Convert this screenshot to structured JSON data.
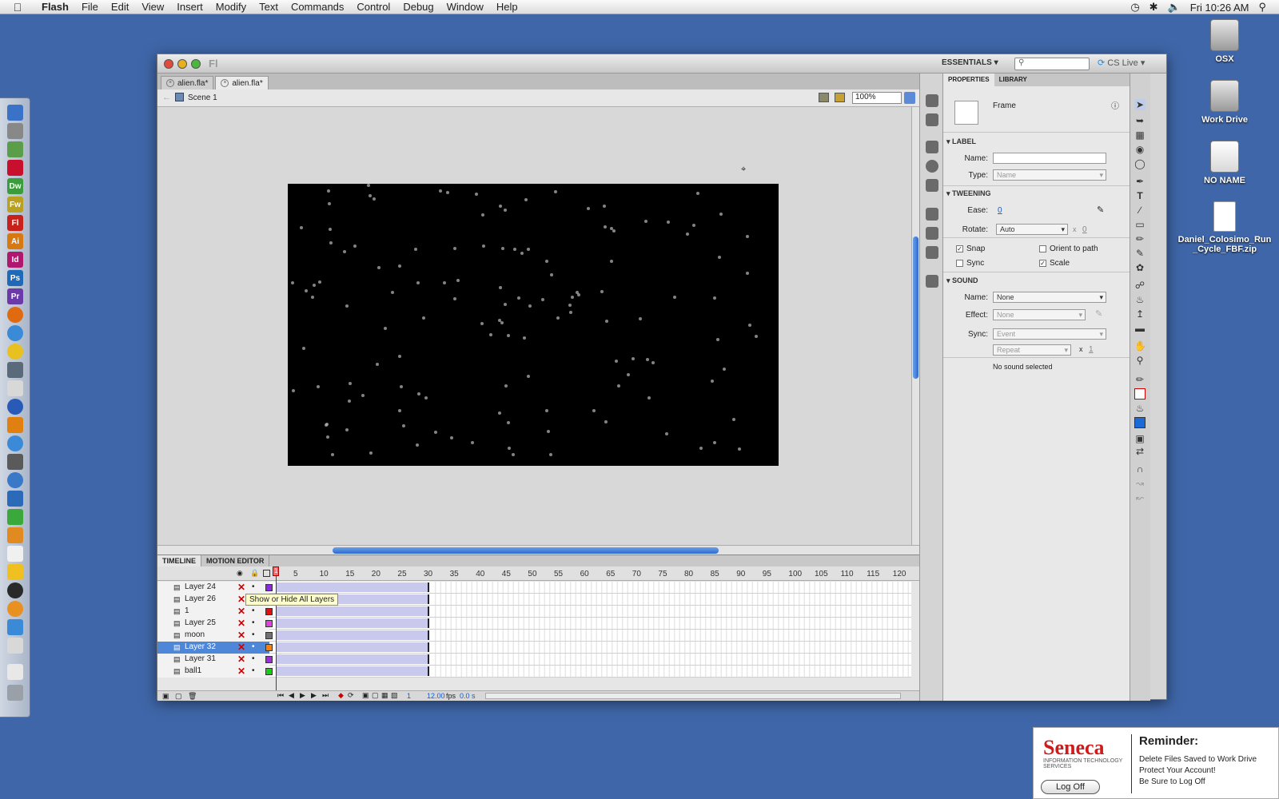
{
  "menubar": {
    "app": "Flash",
    "items": [
      "File",
      "Edit",
      "View",
      "Insert",
      "Modify",
      "Text",
      "Commands",
      "Control",
      "Debug",
      "Window",
      "Help"
    ],
    "clock": "Fri 10:26 AM"
  },
  "desktop": {
    "icons": [
      {
        "label": "OSX"
      },
      {
        "label": "Work Drive"
      },
      {
        "label": "NO NAME"
      },
      {
        "label": "Daniel_Colosimo_Run_Cycle_FBF.zip"
      }
    ]
  },
  "dock": {
    "apps": [
      "Dw",
      "Fw",
      "Fl",
      "Ai",
      "Id",
      "Ps",
      "Pr"
    ]
  },
  "window": {
    "title_logo": "Fl",
    "workspace": "ESSENTIALS",
    "cslive": "CS Live",
    "tabs": [
      "alien.fla*",
      "alien.fla*"
    ],
    "breadcrumb": "Scene 1",
    "zoom": "100%"
  },
  "timeline": {
    "tabs": [
      "TIMELINE",
      "MOTION EDITOR"
    ],
    "frame_numbers": [
      "5",
      "10",
      "15",
      "20",
      "25",
      "30",
      "35",
      "40",
      "45",
      "50",
      "55",
      "60",
      "65",
      "70",
      "75",
      "80",
      "85",
      "90",
      "95",
      "100",
      "105",
      "110",
      "115",
      "120"
    ],
    "current_frame_marker": "1",
    "tooltip": "Show or Hide All Layers",
    "layers": [
      {
        "name": "Layer 24",
        "color": "#8a2be2"
      },
      {
        "name": "Layer 26",
        "color": "#3f8fe0"
      },
      {
        "name": "1",
        "color": "#e01010"
      },
      {
        "name": "Layer 25",
        "color": "#e040e0"
      },
      {
        "name": "moon",
        "color": "#707070"
      },
      {
        "name": "Layer 32",
        "color": "#ff8000"
      },
      {
        "name": "Layer 31",
        "color": "#9b30d0"
      },
      {
        "name": "ball1",
        "color": "#10d010"
      }
    ],
    "current_frame": "1",
    "fps": "12.00",
    "fps_unit": "fps",
    "elapsed": "0.0 s"
  },
  "properties": {
    "tabs": [
      "PROPERTIES",
      "LIBRARY"
    ],
    "type_title": "Frame",
    "label_section": "LABEL",
    "name_label": "Name:",
    "type_label": "Type:",
    "type_value": "Name",
    "tweening_section": "TWEENING",
    "ease_label": "Ease:",
    "ease_value": "0",
    "rotate_label": "Rotate:",
    "rotate_value": "Auto",
    "rotate_times_sep": "x",
    "rotate_count": "0",
    "snap": "Snap",
    "orient": "Orient to path",
    "sync_chk": "Sync",
    "scale": "Scale",
    "sound_section": "SOUND",
    "sound_name_label": "Name:",
    "sound_name_value": "None",
    "effect_label": "Effect:",
    "effect_value": "None",
    "sync_label": "Sync:",
    "sync_value": "Event",
    "repeat_value": "Repeat",
    "repeat_times_sep": "x",
    "repeat_count": "1",
    "status": "No sound selected"
  },
  "reminder": {
    "logo": "Seneca",
    "logo_sub": "INFORMATION TECHNOLOGY SERVICES",
    "title": "Reminder:",
    "lines": [
      "Delete Files Saved to Work Drive",
      "Protect Your Account!",
      "Be Sure to Log Off"
    ],
    "button": "Log Off"
  }
}
